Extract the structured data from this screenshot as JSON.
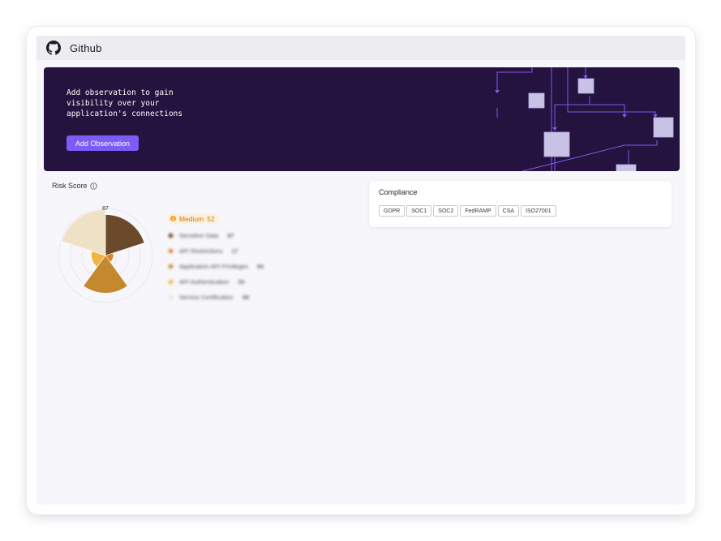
{
  "app": {
    "title": "Github",
    "icon": "github-icon"
  },
  "banner": {
    "message": "Add observation to gain\nvisibility over your\napplication's connections",
    "cta_label": "Add Observation",
    "colors": {
      "background": "#24123f",
      "button": "#7b5cf5",
      "node": "#c8c3e4",
      "line": "#7d5ce8"
    }
  },
  "risk": {
    "label": "Risk Score",
    "info_icon": "info-icon",
    "badge": {
      "level": "Medium",
      "score": "52",
      "icon": "alert-icon"
    },
    "top_value_label": "87",
    "factors": [
      {
        "name": "Sensitive Data",
        "value": 87,
        "color": "#6b4a2b"
      },
      {
        "name": "API Restrictions",
        "value": 17,
        "color": "#d9822b"
      },
      {
        "name": "Application API Privileges",
        "value": 80,
        "color": "#c4882f"
      },
      {
        "name": "API Authentication",
        "value": 30,
        "color": "#f0b441"
      },
      {
        "name": "Service Certification",
        "value": 98,
        "color": "#efe1c6"
      }
    ]
  },
  "compliance": {
    "title": "Compliance",
    "standards": [
      "GDPR",
      "SOC1",
      "SOC2",
      "FedRAMP",
      "CSA",
      "ISO27001"
    ]
  }
}
